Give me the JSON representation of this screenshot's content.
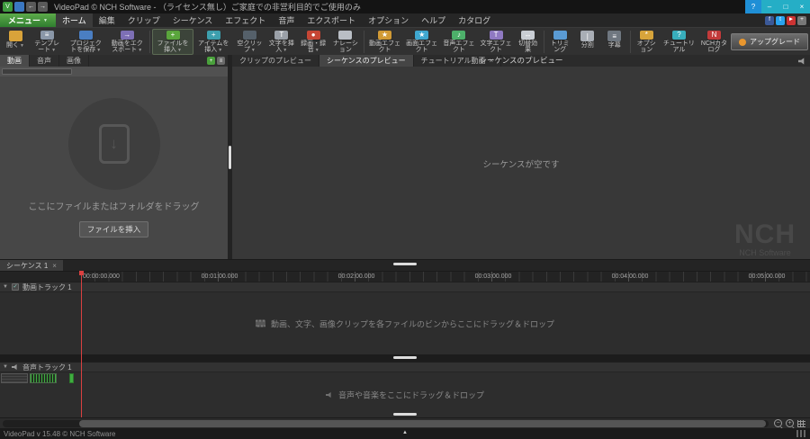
{
  "glyphs": {
    "dropdown": "▼",
    "close": "×",
    "collapse": "▲",
    "check": "✓"
  },
  "titlebar": {
    "icons": [
      {
        "name": "videopad-logo",
        "glyph": "V",
        "color": "#3f9b3f"
      },
      {
        "name": "save-icon",
        "glyph": "",
        "color": "#3a77c2"
      },
      {
        "name": "undo-icon",
        "glyph": "←",
        "color": "#5a5a5a"
      },
      {
        "name": "redo-icon",
        "glyph": "→",
        "color": "#5a5a5a"
      }
    ],
    "title": "VideoPad © NCH Software - （ライセンス無し）ご家庭での非営利目的でご使用のみ",
    "controls": [
      {
        "name": "help-button",
        "glyph": "?",
        "color": "#1f8fd6"
      },
      {
        "name": "minimize-button",
        "glyph": "–",
        "color": "#25aec6"
      },
      {
        "name": "maximize-button",
        "glyph": "□",
        "color": "#25aec6"
      },
      {
        "name": "close-button",
        "glyph": "×",
        "color": "#25aec6"
      }
    ]
  },
  "menubar": {
    "menu_button": "メニュー",
    "tabs": [
      {
        "label": "ホーム",
        "active": true
      },
      {
        "label": "編集"
      },
      {
        "label": "クリップ"
      },
      {
        "label": "シーケンス"
      },
      {
        "label": "エフェクト"
      },
      {
        "label": "音声"
      },
      {
        "label": "エクスポート"
      },
      {
        "label": "オプション"
      },
      {
        "label": "ヘルプ"
      },
      {
        "label": "カタログ"
      }
    ],
    "social": [
      {
        "name": "facebook-icon",
        "glyph": "f",
        "color": "#3b5998"
      },
      {
        "name": "twitter-icon",
        "glyph": "t",
        "color": "#2aa3ef"
      },
      {
        "name": "youtube-icon",
        "glyph": "►",
        "color": "#cc3333"
      },
      {
        "name": "share-icon",
        "glyph": "+",
        "color": "#777777"
      }
    ]
  },
  "ribbon": {
    "groups": [
      {
        "buttons": [
          {
            "name": "open-button",
            "label": "開く",
            "icon": "folder-icon",
            "color": "#d9a33a",
            "glyph": "",
            "arrow": true
          },
          {
            "name": "template-button",
            "label": "テンプレート",
            "icon": "template-icon",
            "color": "#8a97a8",
            "glyph": "≡",
            "arrow": true
          },
          {
            "name": "save-project-button",
            "label": "プロジェクトを保存",
            "icon": "save-project-icon",
            "color": "#4a7ec2",
            "glyph": "",
            "arrow": true
          },
          {
            "name": "export-video-button",
            "label": "動画をエクスポート",
            "icon": "export-icon",
            "color": "#7d6fb5",
            "glyph": "→",
            "arrow": true
          }
        ]
      },
      {
        "buttons": [
          {
            "name": "insert-file-button",
            "label": "ファイルを挿入",
            "icon": "insert-file-icon",
            "color": "#5aa63c",
            "glyph": "+",
            "arrow": true,
            "active": true
          },
          {
            "name": "insert-item-button",
            "label": "アイテムを挿入",
            "icon": "insert-item-icon",
            "color": "#3d9fae",
            "glyph": "+",
            "arrow": true
          },
          {
            "name": "blank-clip-button",
            "label": "空クリップ",
            "icon": "blank-clip-icon",
            "color": "#55606a",
            "glyph": "",
            "arrow": true
          },
          {
            "name": "insert-text-button",
            "label": "文字を挿入",
            "icon": "insert-text-icon",
            "color": "#9aa0a8",
            "glyph": "T",
            "arrow": true
          },
          {
            "name": "record-button",
            "label": "録画・録音",
            "icon": "record-icon",
            "color": "#c64635",
            "glyph": "●",
            "arrow": true
          },
          {
            "name": "narration-button",
            "label": "ナレーション",
            "icon": "narration-icon",
            "color": "#b9bec5",
            "glyph": ""
          }
        ]
      },
      {
        "buttons": [
          {
            "name": "video-effects-button",
            "label": "動画エフェクト",
            "icon": "video-effects-icon",
            "color": "#d19a35",
            "glyph": "★"
          },
          {
            "name": "screen-effects-button",
            "label": "画面エフェクト",
            "icon": "screen-effects-icon",
            "color": "#3fa7cf",
            "glyph": "★"
          },
          {
            "name": "audio-effects-button",
            "label": "音声エフェクト",
            "icon": "audio-effects-icon",
            "color": "#4db06a",
            "glyph": "♪"
          },
          {
            "name": "text-effects-button",
            "label": "文字エフェクト",
            "icon": "text-effects-icon",
            "color": "#8f79c2",
            "glyph": "T"
          },
          {
            "name": "transitions-button",
            "label": "切替効果",
            "icon": "transitions-icon",
            "color": "#c9ced4",
            "glyph": "↔"
          }
        ]
      },
      {
        "buttons": [
          {
            "name": "trim-button",
            "label": "トリミング",
            "icon": "trim-icon",
            "color": "#5a9bd4",
            "glyph": ""
          },
          {
            "name": "split-button",
            "label": "分割",
            "icon": "split-icon",
            "color": "#a9aeb5",
            "glyph": "|"
          },
          {
            "name": "subtitles-button",
            "label": "字幕",
            "icon": "subtitles-icon",
            "color": "#6f7780",
            "glyph": "≡"
          }
        ]
      },
      {
        "buttons": [
          {
            "name": "options-button",
            "label": "オプション",
            "icon": "options-icon",
            "color": "#d7a43b",
            "glyph": "*"
          },
          {
            "name": "tutorial-button",
            "label": "チュートリアル",
            "icon": "tutorial-icon",
            "color": "#38aebc",
            "glyph": "?"
          },
          {
            "name": "nch-catalog-button",
            "label": "NCHカタログ",
            "icon": "nch-catalog-icon",
            "color": "#c23a3a",
            "glyph": "N"
          }
        ]
      }
    ],
    "upgrade_label": "アップグレード"
  },
  "left_panel": {
    "tabs": [
      {
        "label": "動画",
        "active": true
      },
      {
        "label": "音声"
      },
      {
        "label": "画像"
      }
    ],
    "icons": [
      {
        "name": "add-media-icon",
        "glyph": "+",
        "color": "#4aa13c"
      },
      {
        "name": "view-mode-icon",
        "glyph": "≡",
        "color": "#6a6a6a"
      }
    ],
    "drop_text": "ここにファイルまたはフォルダをドラッグ",
    "insert_button": "ファイルを挿入",
    "doc_arrow": "↓"
  },
  "preview": {
    "tabs": [
      {
        "label": "クリップのプレビュー"
      },
      {
        "label": "シーケンスのプレビュー",
        "active": true
      },
      {
        "label": "チュートリアル動画",
        "closable": true
      }
    ],
    "title": "シーケンスのプレビュー",
    "empty_text": "シーケンスが空です",
    "watermark_big": "NCH",
    "watermark_small": "NCH Software"
  },
  "timeline": {
    "sequence_tab": "シーケンス 1",
    "ruler_ticks": [
      "00:00:00.000",
      "00:01:00.000",
      "00:02:00.000",
      "00:03:00.000",
      "00:04:00.000",
      "00:05:00.000"
    ],
    "video_track": {
      "label": "動画トラック 1",
      "message": "動画、文字、画像クリップを各ファイルのビンからここにドラッグ＆ドロップ"
    },
    "audio_track": {
      "label": "音声トラック 1",
      "message": "音声や音楽をここにドラッグ＆ドロップ"
    }
  },
  "scrollbar": {
    "zoom_out": "−",
    "zoom_in": "+"
  },
  "statusbar": {
    "text": "VideoPad v 15.48 © NCH Software"
  }
}
